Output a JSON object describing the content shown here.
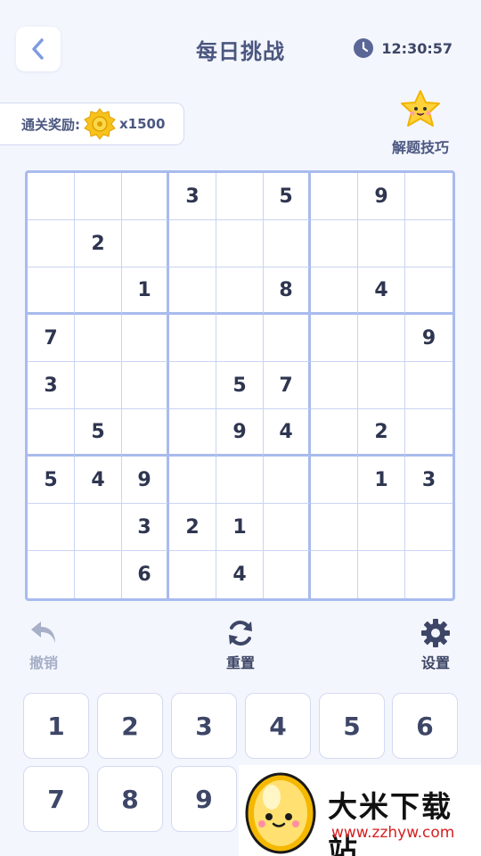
{
  "header": {
    "title": "每日挑战",
    "time": "12:30:57"
  },
  "reward": {
    "label": "通关奖励:",
    "count": "x1500"
  },
  "tips": {
    "label": "解题技巧"
  },
  "board": {
    "rows": [
      [
        "",
        "",
        "",
        "3",
        "",
        "5",
        "",
        "9",
        ""
      ],
      [
        "",
        "2",
        "",
        "",
        "",
        "",
        "",
        "",
        ""
      ],
      [
        "",
        "",
        "1",
        "",
        "",
        "8",
        "",
        "4",
        ""
      ],
      [
        "7",
        "",
        "",
        "",
        "",
        "",
        "",
        "",
        "9"
      ],
      [
        "3",
        "",
        "",
        "",
        "5",
        "7",
        "",
        "",
        ""
      ],
      [
        "",
        "5",
        "",
        "",
        "9",
        "4",
        "",
        "2",
        ""
      ],
      [
        "5",
        "4",
        "9",
        "",
        "",
        "",
        "",
        "1",
        "3"
      ],
      [
        "",
        "",
        "3",
        "2",
        "1",
        "",
        "",
        "",
        ""
      ],
      [
        "",
        "",
        "6",
        "",
        "4",
        "",
        "",
        "",
        ""
      ]
    ]
  },
  "actions": {
    "undo": "撤销",
    "reset": "重置",
    "settings": "设置"
  },
  "numpad": [
    "1",
    "2",
    "3",
    "4",
    "5",
    "6",
    "7",
    "8",
    "9"
  ],
  "watermark": {
    "brand": "大米下载站",
    "url": "www.zzhyw.com"
  },
  "colors": {
    "background": "#f4f6fd",
    "grid": "#a9bbee",
    "text": "#2e3550",
    "disabled": "#a7b0c8",
    "coin": "#f7c21c"
  },
  "icons": {
    "back": "chevron-left-icon",
    "clock": "clock-icon",
    "coin": "coin-icon",
    "star": "star-mascot-icon",
    "undo": "undo-icon",
    "reset": "refresh-icon",
    "settings": "gear-icon",
    "mascot": "egg-mascot-icon"
  }
}
